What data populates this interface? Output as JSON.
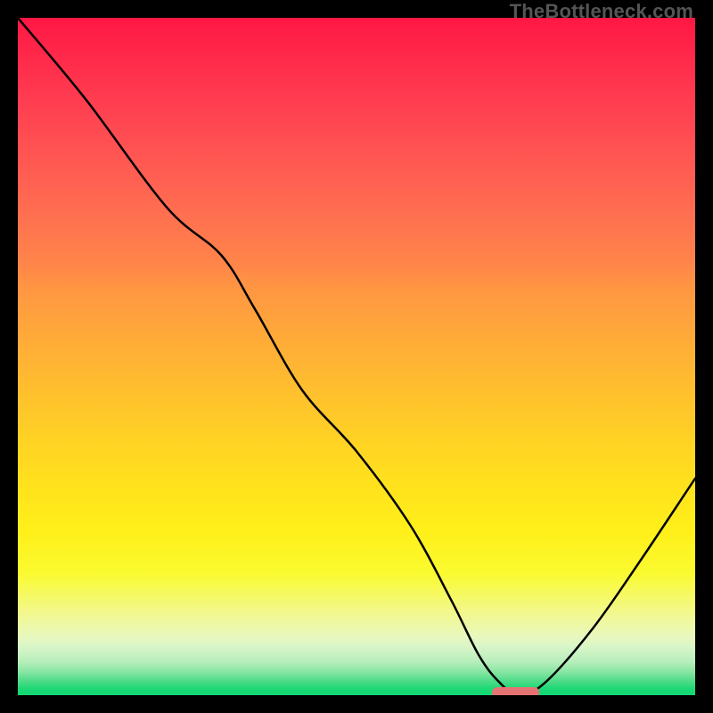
{
  "watermark": "TheBottleneck.com",
  "chart_data": {
    "type": "line",
    "title": "",
    "xlabel": "",
    "ylabel": "",
    "xlim": [
      0,
      100
    ],
    "ylim": [
      0,
      100
    ],
    "grid": false,
    "series": [
      {
        "name": "bottleneck-curve",
        "x": [
          0,
          10,
          22,
          30,
          35,
          42,
          50,
          58,
          64,
          68,
          71,
          74,
          78,
          85,
          92,
          100
        ],
        "values": [
          100,
          88,
          72,
          65,
          57,
          45,
          36,
          25,
          14,
          6,
          2,
          0,
          2,
          10,
          20,
          32
        ]
      }
    ],
    "marker": {
      "name": "optimal-zone",
      "x_start": 70,
      "x_end": 77,
      "y": 0,
      "color": "#e57373"
    },
    "gradient_stops": [
      {
        "pos": 0,
        "color": "#ff1744"
      },
      {
        "pos": 50,
        "color": "#ffb732"
      },
      {
        "pos": 80,
        "color": "#fafa30"
      },
      {
        "pos": 100,
        "color": "#11d873"
      }
    ]
  }
}
